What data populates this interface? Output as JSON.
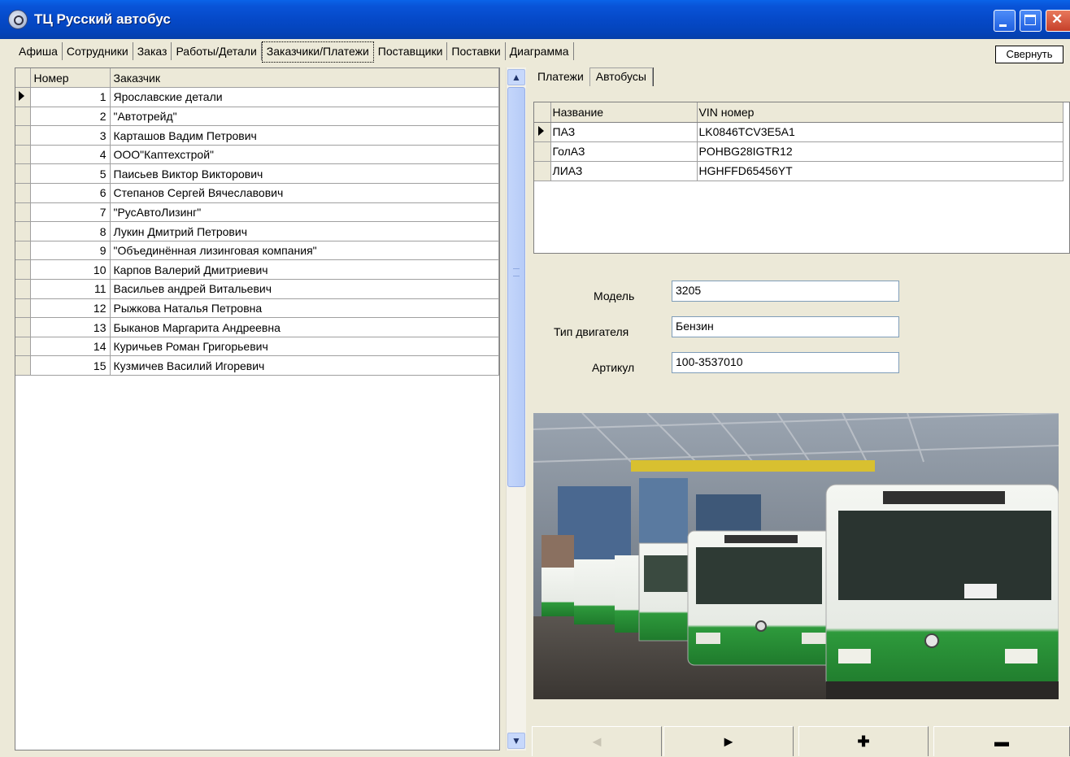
{
  "window": {
    "title": "ТЦ Русский автобус",
    "collapse_label": "Свернуть"
  },
  "tabs": [
    "Афиша",
    "Сотрудники",
    "Заказ",
    "Работы/Детали",
    "Заказчики/Платежи",
    "Поставщики",
    "Поставки",
    "Диаграмма"
  ],
  "active_tab": "Заказчики/Платежи",
  "customers": {
    "headers": {
      "number": "Номер",
      "customer": "Заказчик"
    },
    "rows": [
      {
        "number": "1",
        "name": "Ярославские детали"
      },
      {
        "number": "2",
        "name": "\"Автотрейд\""
      },
      {
        "number": "3",
        "name": "Карташов Вадим Петрович"
      },
      {
        "number": "4",
        "name": "ООО\"Каптехстрой\""
      },
      {
        "number": "5",
        "name": "Паисьев Виктор Викторович"
      },
      {
        "number": "6",
        "name": "Степанов Сергей Вячеславович"
      },
      {
        "number": "7",
        "name": "\"РусАвтоЛизинг\""
      },
      {
        "number": "8",
        "name": "Лукин Дмитрий Петрович"
      },
      {
        "number": "9",
        "name": "\"Объединённая лизинговая компания\""
      },
      {
        "number": "10",
        "name": "Карпов Валерий Дмитриевич"
      },
      {
        "number": "11",
        "name": "Васильев андрей Витальевич"
      },
      {
        "number": "12",
        "name": "Рыжкова Наталья Петровна"
      },
      {
        "number": "13",
        "name": "Быканов Маргарита Андреевна"
      },
      {
        "number": "14",
        "name": "Куричьев Роман Григорьевич"
      },
      {
        "number": "15",
        "name": "Кузмичев Василий Игоревич"
      }
    ]
  },
  "inner_tabs": [
    "Платежи",
    "Автобусы"
  ],
  "inner_active": "Автобусы",
  "buses": {
    "headers": {
      "name": "Название",
      "vin": "VIN номер"
    },
    "rows": [
      {
        "name": "ПАЗ",
        "vin": "LK0846TCV3E5A1"
      },
      {
        "name": "ГолАЗ",
        "vin": "POHBG28IGTR12"
      },
      {
        "name": "ЛИАЗ",
        "vin": "HGHFFD65456YT"
      }
    ]
  },
  "details": {
    "model_label": "Модель",
    "model_value": "3205",
    "engine_label": "Тип двигателя",
    "engine_value": "Бензин",
    "article_label": "Артикул",
    "article_value": "100-3537010"
  },
  "navigator": {
    "prev": "◄",
    "next": "►",
    "add": "✚",
    "remove": "▬"
  }
}
